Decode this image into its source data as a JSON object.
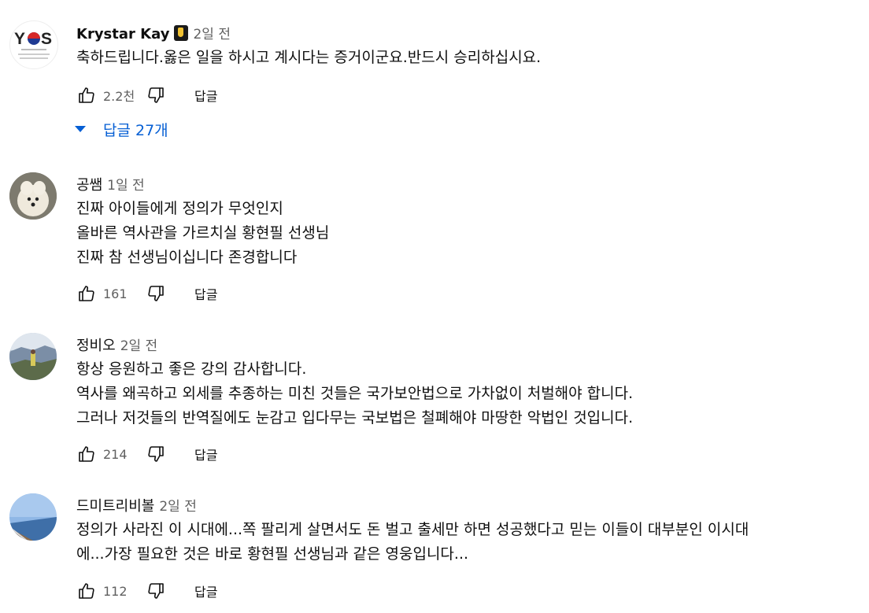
{
  "comments": [
    {
      "author": "Krystar Kay",
      "time": "2일 전",
      "lines": [
        "축하드립니다.옳은 일을 하시고 계시다는 증거이군요.반드시 승리하십시요."
      ],
      "likes": "2.2천",
      "reply_label": "답글",
      "avatar_text": "YOS",
      "avatar_sub": "I LOVE KOREA",
      "replies_label": "답글 27개"
    },
    {
      "author": "공쌤",
      "time": "1일 전",
      "lines": [
        "진짜 아이들에게 정의가 무엇인지",
        "올바른 역사관을 가르치실 황현필 선생님",
        "진짜 참 선생님이십니다 존경합니다"
      ],
      "likes": "161",
      "reply_label": "답글"
    },
    {
      "author": "정비오",
      "time": "2일 전",
      "lines": [
        "항상 응원하고 좋은 강의 감사합니다.",
        "역사를 왜곡하고 외세를 추종하는 미친 것들은 국가보안법으로 가차없이 처벌해야 합니다.",
        "그러나 저것들의 반역질에도 눈감고 입다무는 국보법은 철폐해야 마땅한 악법인 것입니다."
      ],
      "likes": "214",
      "reply_label": "답글"
    },
    {
      "author": "드미트리비볼",
      "time": "2일 전",
      "lines": [
        "정의가 사라진  이 시대에...쪽 팔리게 살면서도 돈 벌고 출세만 하면 성공했다고 믿는 이들이 대부분인 이시대",
        "에...가장 필요한 것은 바로 황현필 선생님과 같은 영웅입니다..."
      ],
      "likes": "112",
      "reply_label": "답글"
    }
  ],
  "colors": {
    "link": "#065fd4",
    "meta": "#606060",
    "text": "#0f0f0f"
  },
  "icons": {
    "like": "thumbs-up-icon",
    "dislike": "thumbs-down-icon",
    "replies": "caret-down-icon"
  }
}
